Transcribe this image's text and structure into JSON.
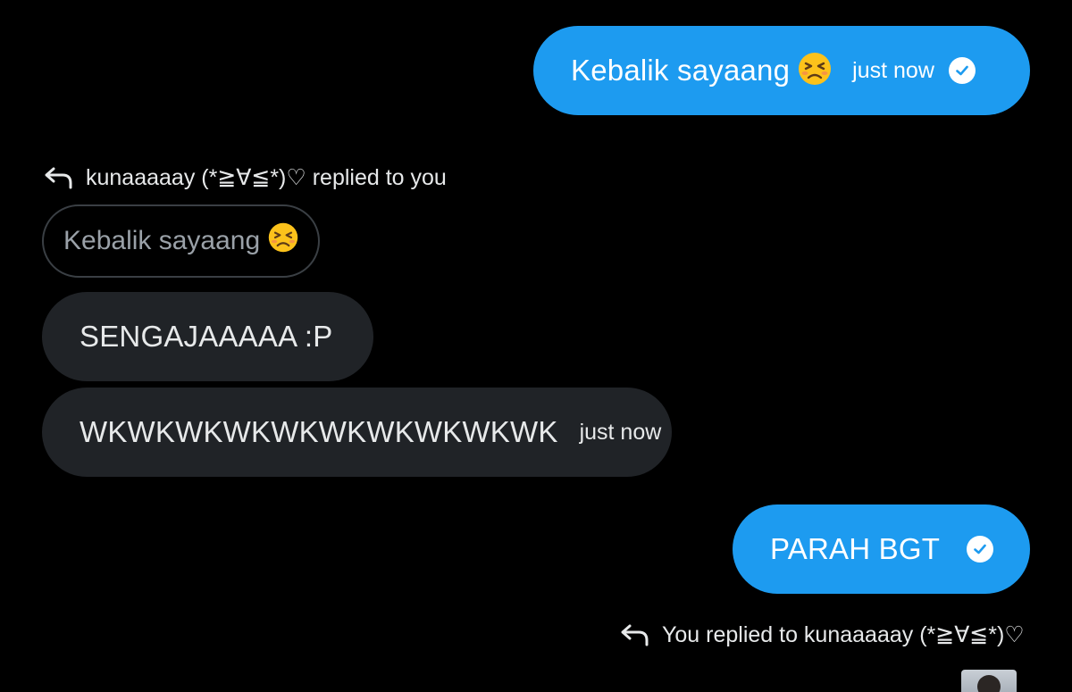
{
  "messages": [
    {
      "text": "Kebalik sayaang",
      "emoji": "tired-face-emoji",
      "time": "just now",
      "status": "read"
    },
    {
      "text": "SENGAJAAAAA :P"
    },
    {
      "text": "WKWKWKWKWKWKWKWKWKWK",
      "time": "just now"
    },
    {
      "text": "PARAH BGT",
      "status": "read"
    }
  ],
  "reply_labels": {
    "received": "kunaaaaay (*≧∀≦*)♡ replied to you",
    "sent": "You replied to kunaaaaay (*≧∀≦*)♡"
  },
  "quoted_message": {
    "text": "Kebalik sayaang",
    "emoji": "tired-face-emoji"
  },
  "colors": {
    "background": "#000000",
    "sent_bubble": "#1d9bf0",
    "received_bubble": "#202327",
    "text": "#e7e9ea",
    "quoted_text": "#9aa1a8"
  }
}
